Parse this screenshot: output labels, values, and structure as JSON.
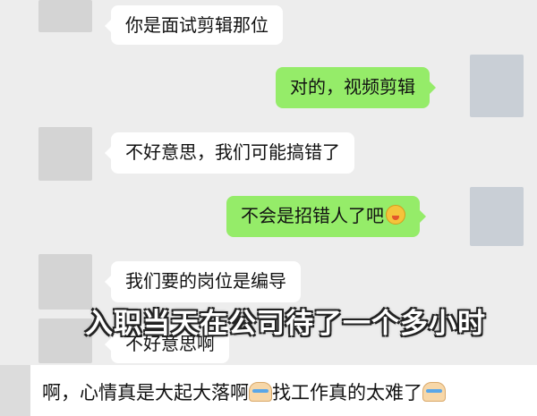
{
  "messages": [
    {
      "side": "left",
      "text": "你是面试剪辑那位"
    },
    {
      "side": "right",
      "text": "对的，视频剪辑"
    },
    {
      "side": "left",
      "text": "不好意思，我们可能搞错了"
    },
    {
      "side": "right",
      "text": "不会是招错人了吧",
      "emoji": "grimacing-face"
    },
    {
      "side": "left",
      "text": "我们要的岗位是编导"
    },
    {
      "side": "left",
      "text": "不好意思啊"
    }
  ],
  "overlay_text": "入职当天在公司待了一个多小时",
  "caption": {
    "part1": "啊，心情真是大起大落啊",
    "part2": "找工作真的太难了",
    "emoji": "crying-face"
  },
  "colors": {
    "background": "#ededed",
    "incoming": "#ffffff",
    "outgoing": "#95ec69"
  }
}
